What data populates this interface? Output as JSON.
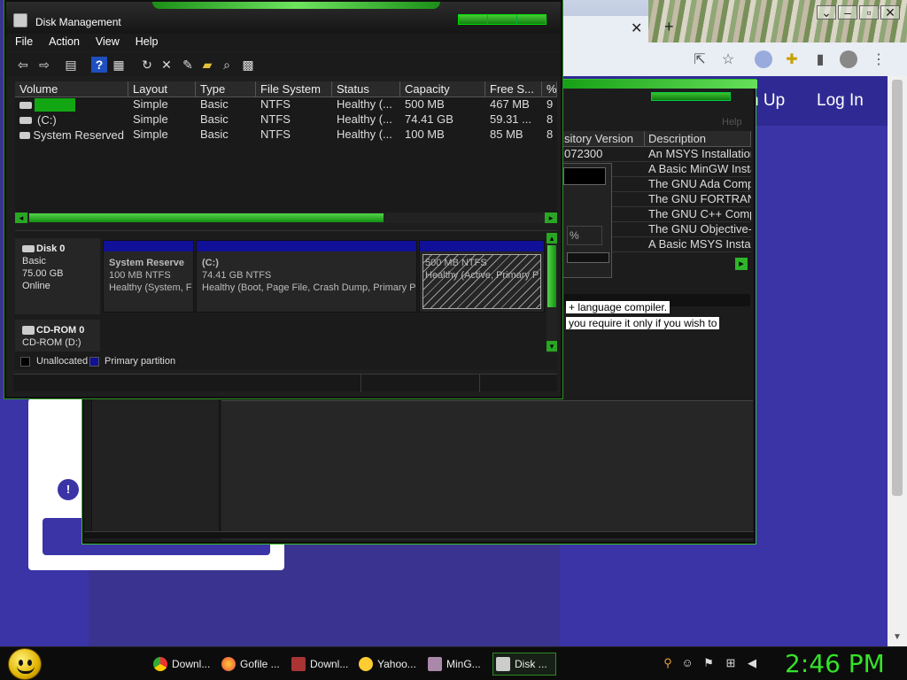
{
  "browser": {
    "nav_signup": "n Up",
    "nav_login": "Log In",
    "close_tab": "✕",
    "new_tab": "+"
  },
  "mingw": {
    "help": "Help",
    "columns": [
      "sitory Version",
      "Description"
    ],
    "rows": [
      [
        "072300",
        "An MSYS Installation"
      ],
      [
        "",
        "A Basic MinGW Insta"
      ],
      [
        "",
        "The GNU Ada Comp"
      ],
      [
        "",
        "The GNU FORTRAN"
      ],
      [
        "",
        "The GNU C++ Comp"
      ],
      [
        "",
        "The GNU Objective-"
      ],
      [
        "",
        "A Basic MSYS Instal"
      ]
    ],
    "pct": "%",
    "desc_line1": "+ language compiler.",
    "desc_line2": "you require it only if you wish to"
  },
  "dm": {
    "title": "Disk Management",
    "menu": [
      "File",
      "Action",
      "View",
      "Help"
    ],
    "columns": [
      "Volume",
      "Layout",
      "Type",
      "File System",
      "Status",
      "Capacity",
      "Free S...",
      "%"
    ],
    "rows": [
      {
        "volume": "",
        "layout": "Simple",
        "type": "Basic",
        "fs": "NTFS",
        "status": "Healthy (...",
        "capacity": "500 MB",
        "free": "467 MB",
        "pct": "9"
      },
      {
        "volume": "(C:)",
        "layout": "Simple",
        "type": "Basic",
        "fs": "NTFS",
        "status": "Healthy (...",
        "capacity": "74.41 GB",
        "free": "59.31 ...",
        "pct": "8"
      },
      {
        "volume": "System Reserved",
        "layout": "Simple",
        "type": "Basic",
        "fs": "NTFS",
        "status": "Healthy (...",
        "capacity": "100 MB",
        "free": "85 MB",
        "pct": "8"
      }
    ],
    "disk0": {
      "name": "Disk 0",
      "type": "Basic",
      "size": "75.00 GB",
      "state": "Online"
    },
    "cdrom": {
      "name": "CD-ROM 0",
      "drive": "CD-ROM (D:)"
    },
    "partitions": [
      {
        "name": "System Reserve",
        "size": "100 MB NTFS",
        "status": "Healthy (System, F"
      },
      {
        "name": "(C:)",
        "size": "74.41 GB NTFS",
        "status": "Healthy (Boot, Page File, Crash Dump, Primary Par"
      },
      {
        "name": "",
        "size": "500 MB NTFS",
        "status": "Healthy (Active, Primary P"
      }
    ],
    "legend": {
      "unallocated": "Unallocated",
      "primary": "Primary partition"
    }
  },
  "taskbar": {
    "tasks": [
      "Downl...",
      "Gofile ...",
      "Downl...",
      "Yahoo...",
      "MinG...",
      "Disk ..."
    ],
    "clock": "2:46 PM"
  }
}
